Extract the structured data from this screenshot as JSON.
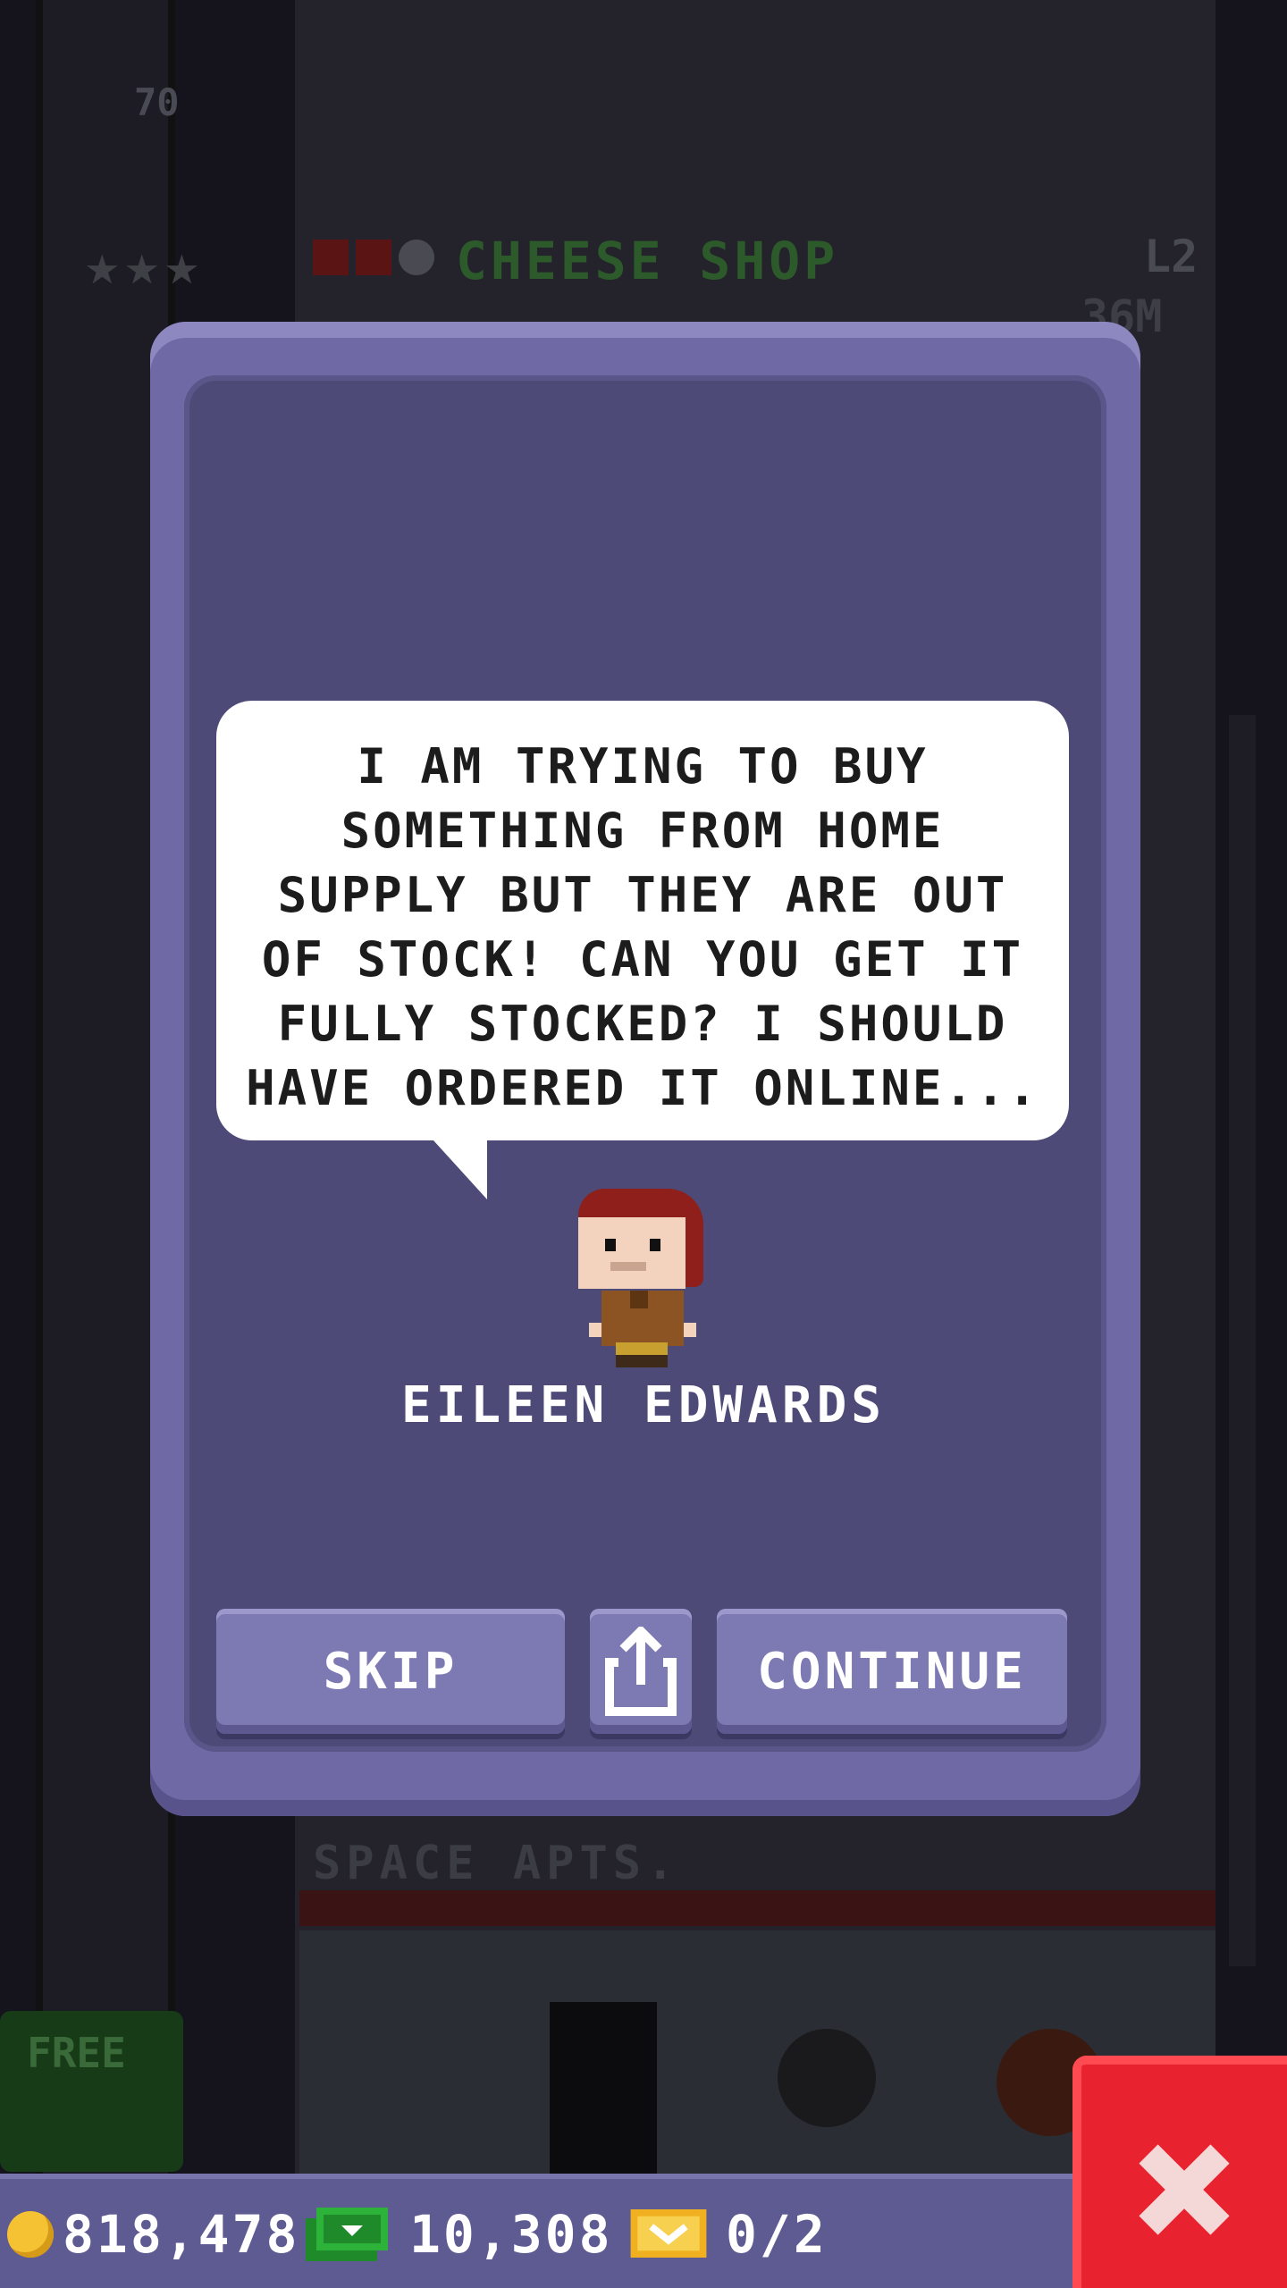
{
  "background": {
    "floor_number": "70",
    "floor_title": "CHEESE SHOP",
    "floor_level": "L2",
    "floor_money": "36M",
    "apartment_title": "SPACE APTS.",
    "free_label": "FREE"
  },
  "dialog": {
    "message": "I AM TRYING TO BUY\nSOMETHING FROM HOME\nSUPPLY BUT THEY ARE OUT\nOF STOCK! CAN YOU GET IT\nFULLY STOCKED? I SHOULD\nHAVE ORDERED IT ONLINE...",
    "character_name": "EILEEN EDWARDS",
    "buttons": {
      "skip": "SKIP",
      "share_icon": "share-icon",
      "continue": "CONTINUE"
    }
  },
  "hud": {
    "coins": "818,478",
    "bux": "10,308",
    "tickets": "0/2",
    "icons": [
      "coin-icon",
      "cash-icon",
      "ticket-icon",
      "close-icon"
    ]
  },
  "colors": {
    "dialog_frame": "#6f6aa6",
    "dialog_inner": "#4e4a78",
    "button": "#7d79b2",
    "close_button": "#e8222e",
    "hud_bar": "#5e5a92"
  }
}
